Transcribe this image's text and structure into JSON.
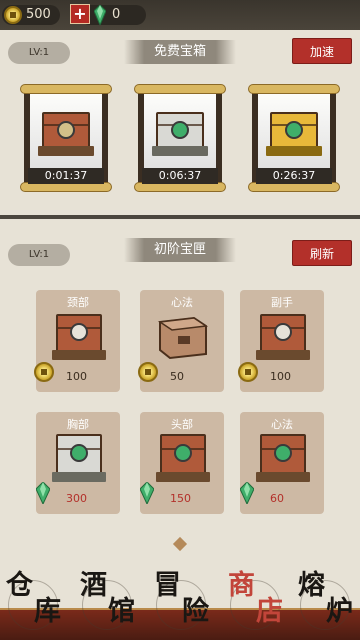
{
  "topbar": {
    "coins": "500",
    "gems": "0",
    "plus_label": "+"
  },
  "free_section": {
    "level": "LV:1",
    "title": "免费宝箱",
    "action_label": "加速",
    "chests": [
      {
        "rarity": "bronze",
        "timer": "0:01:37"
      },
      {
        "rarity": "silver",
        "timer": "0:06:37"
      },
      {
        "rarity": "gold",
        "timer": "0:26:37"
      }
    ]
  },
  "shop_section": {
    "level": "LV:1",
    "title": "初阶宝匣",
    "action_label": "刷新",
    "items": [
      {
        "name": "颈部",
        "price": "100",
        "currency": "coin",
        "chest": "bronze"
      },
      {
        "name": "心法",
        "price": "50",
        "currency": "coin",
        "chest": "bag"
      },
      {
        "name": "副手",
        "price": "100",
        "currency": "coin",
        "chest": "bronze"
      },
      {
        "name": "胸部",
        "price": "300",
        "currency": "gem",
        "chest": "silver"
      },
      {
        "name": "头部",
        "price": "150",
        "currency": "gem",
        "chest": "bronze"
      },
      {
        "name": "心法",
        "price": "60",
        "currency": "gem",
        "chest": "bronze"
      }
    ]
  },
  "nav": [
    {
      "c1": "仓",
      "c2": "库",
      "active": false
    },
    {
      "c1": "酒",
      "c2": "馆",
      "active": false
    },
    {
      "c1": "冒",
      "c2": "险",
      "active": false
    },
    {
      "c1": "商",
      "c2": "店",
      "active": true
    },
    {
      "c1": "熔",
      "c2": "炉",
      "active": false
    }
  ],
  "colors": {
    "accent_red": "#b3302a",
    "coin_gold": "#c9a227",
    "gem_green": "#3fae6a"
  }
}
